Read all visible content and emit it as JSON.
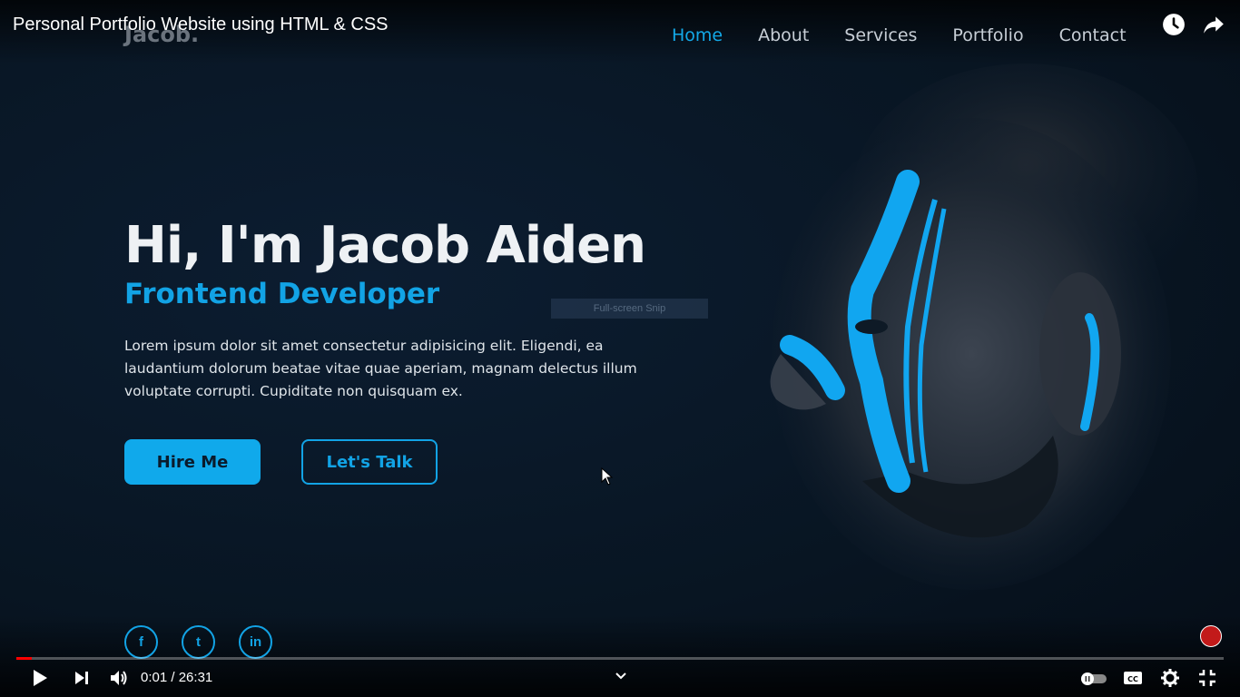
{
  "video": {
    "title": "Personal Portfolio Website using HTML & CSS",
    "time_current": "0:01",
    "time_total": "26:31",
    "progress": 0.013
  },
  "site": {
    "logo": "Jacob.",
    "nav": [
      {
        "label": "Home",
        "active": true
      },
      {
        "label": "About",
        "active": false
      },
      {
        "label": "Services",
        "active": false
      },
      {
        "label": "Portfolio",
        "active": false
      },
      {
        "label": "Contact",
        "active": false
      }
    ],
    "hero": {
      "title": "Hi, I'm Jacob Aiden",
      "subtitle": "Frontend Developer",
      "text": "Lorem ipsum dolor sit amet consectetur adipisicing elit. Eligendi, ea laudantium dolorum beatae vitae quae aperiam, magnam delectus illum voluptate corrupti. Cupiditate non quisquam ex.",
      "primary_button": "Hire Me",
      "secondary_button": "Let's Talk"
    },
    "socials": [
      {
        "icon": "facebook-icon",
        "glyph": "f"
      },
      {
        "icon": "twitter-icon",
        "glyph": "t"
      },
      {
        "icon": "linkedin-icon",
        "glyph": "in"
      }
    ]
  },
  "overlay": {
    "snip_label": "Full-screen Snip"
  },
  "colors": {
    "accent": "#12a3e5",
    "background": "#0a1726",
    "progress": "#ff0000"
  }
}
